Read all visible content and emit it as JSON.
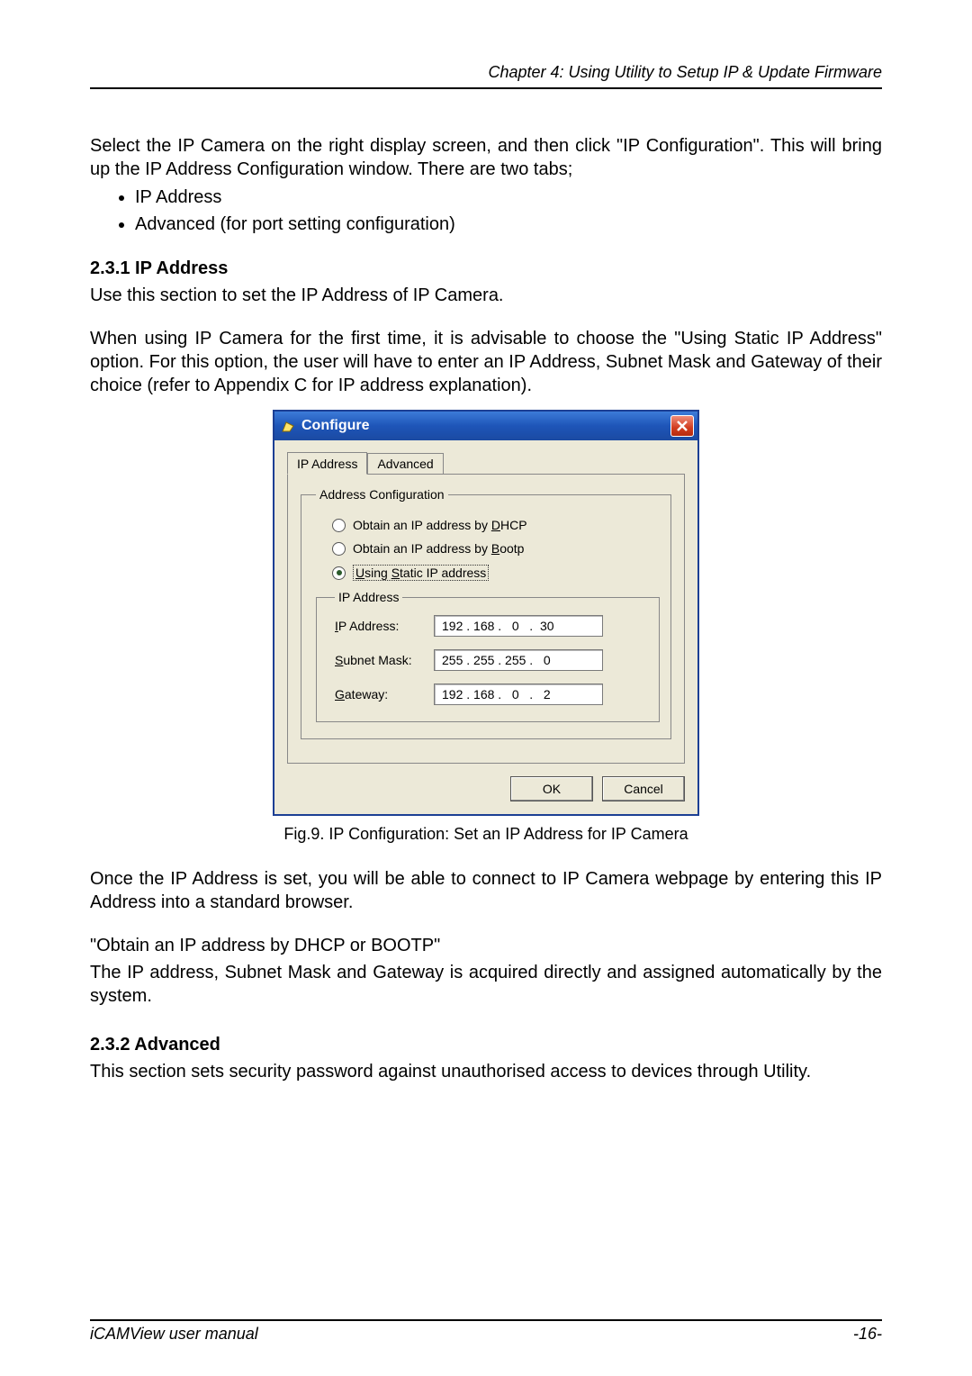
{
  "header": {
    "chapter": "Chapter 4: Using Utility to Setup IP & Update Firmware"
  },
  "intro": {
    "p1": "Select the IP Camera on the right display screen, and then click \"IP Configuration\". This will bring up the IP Address Configuration window. There are two tabs;",
    "bullet1": "IP Address",
    "bullet2": "Advanced (for port setting configuration)"
  },
  "sec231": {
    "title": "2.3.1 IP Address",
    "p1": "Use this section to set the IP Address of IP Camera.",
    "p2": "When using IP Camera for the first time, it is advisable to choose the \"Using Static IP Address\" option.   For this option, the user will have to enter an IP Address, Subnet Mask and Gateway of their choice (refer to Appendix C for IP address explanation)."
  },
  "dialog": {
    "title": "Configure",
    "tabs": {
      "ip": "IP Address",
      "advanced": "Advanced"
    },
    "group_label": "Address Configuration",
    "opt_dhcp_pre": "Obtain an IP address by ",
    "opt_dhcp_mn": "D",
    "opt_dhcp_post": "HCP",
    "opt_bootp_pre": "Obtain an IP address by ",
    "opt_bootp_mn": "B",
    "opt_bootp_post": "ootp",
    "opt_static_mn1": "U",
    "opt_static_mid1": "sing ",
    "opt_static_mn2": "S",
    "opt_static_post": "tatic IP address",
    "ip_group_label": "IP Address",
    "lbl_ip_mn": "I",
    "lbl_ip_post": "P Address:",
    "lbl_sm_mn": "S",
    "lbl_sm_post": "ubnet Mask:",
    "lbl_gw_mn": "G",
    "lbl_gw_post": "ateway:",
    "ip_value": "192 . 168 .   0   .  30",
    "sm_value": "255 . 255 . 255 .   0",
    "gw_value": "192 . 168 .   0   .   2",
    "ok": "OK",
    "cancel": "Cancel"
  },
  "fig_caption": "Fig.9.  IP Configuration: Set an IP Address for IP Camera",
  "after": {
    "p1": "Once the IP Address is set, you will be able to connect to IP Camera webpage by entering this IP Address into a standard browser.",
    "p2": "\"Obtain an IP address by DHCP or BOOTP\"",
    "p3": "The IP address, Subnet Mask and Gateway is acquired directly and assigned automatically by the system."
  },
  "sec232": {
    "title": "2.3.2 Advanced",
    "p1": "This section sets security password against unauthorised access to devices through Utility."
  },
  "footer": {
    "left": "iCAMView  user  manual",
    "right": "-16-"
  }
}
